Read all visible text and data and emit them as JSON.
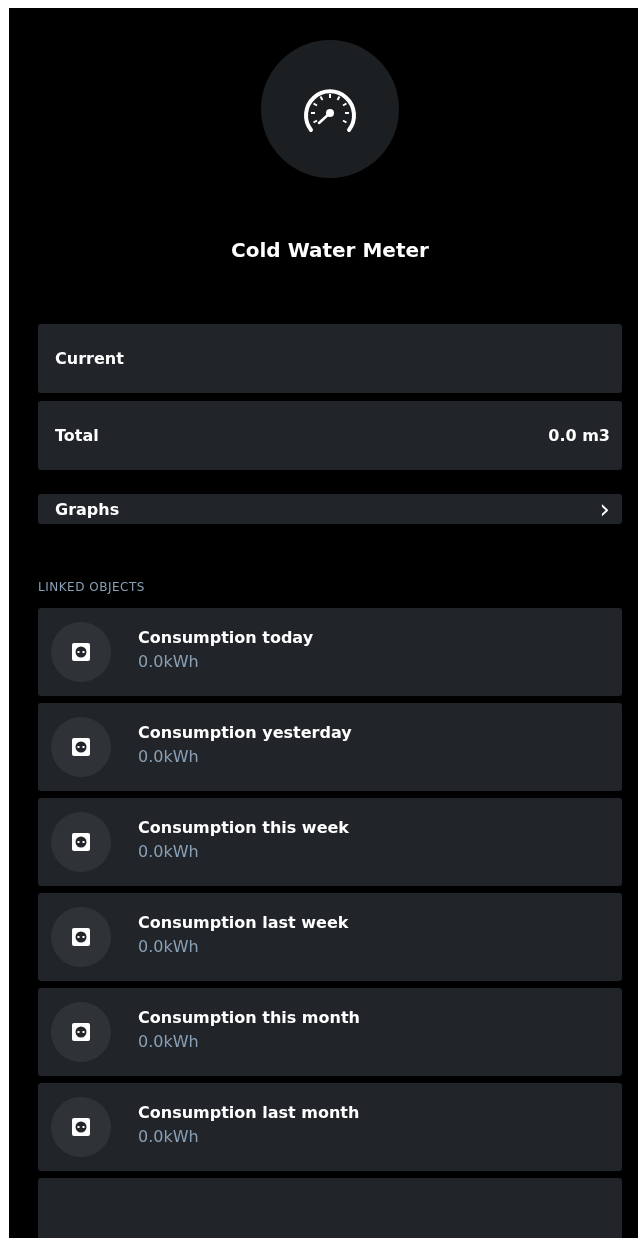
{
  "device": {
    "title": "Cold Water Meter"
  },
  "values": [
    {
      "label": "Current"
    },
    {
      "label": "Total",
      "value": "0.0 m3"
    }
  ],
  "graphs": {
    "label": "Graphs",
    "chevron": "›"
  },
  "linked_objects": {
    "heading": "LINKED OBJECTS",
    "items": [
      {
        "name": "Consumption today",
        "value": "0.0kWh"
      },
      {
        "name": "Consumption yesterday",
        "value": "0.0kWh"
      },
      {
        "name": "Consumption this week",
        "value": "0.0kWh"
      },
      {
        "name": "Consumption last week",
        "value": "0.0kWh"
      },
      {
        "name": "Consumption this month",
        "value": "0.0kWh"
      },
      {
        "name": "Consumption last month",
        "value": "0.0kWh"
      }
    ]
  }
}
